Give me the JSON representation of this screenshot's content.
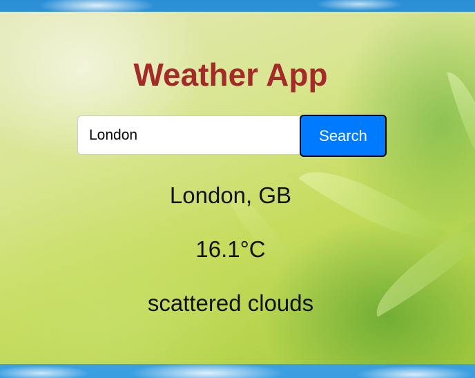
{
  "app": {
    "title": "Weather App"
  },
  "search": {
    "value": "London",
    "placeholder": "",
    "button_label": "Search"
  },
  "weather": {
    "location": "London, GB",
    "temperature": "16.1°C",
    "description": "scattered clouds"
  },
  "colors": {
    "title": "#a52a2a",
    "button": "#007bff",
    "button_text": "#ffffff"
  }
}
